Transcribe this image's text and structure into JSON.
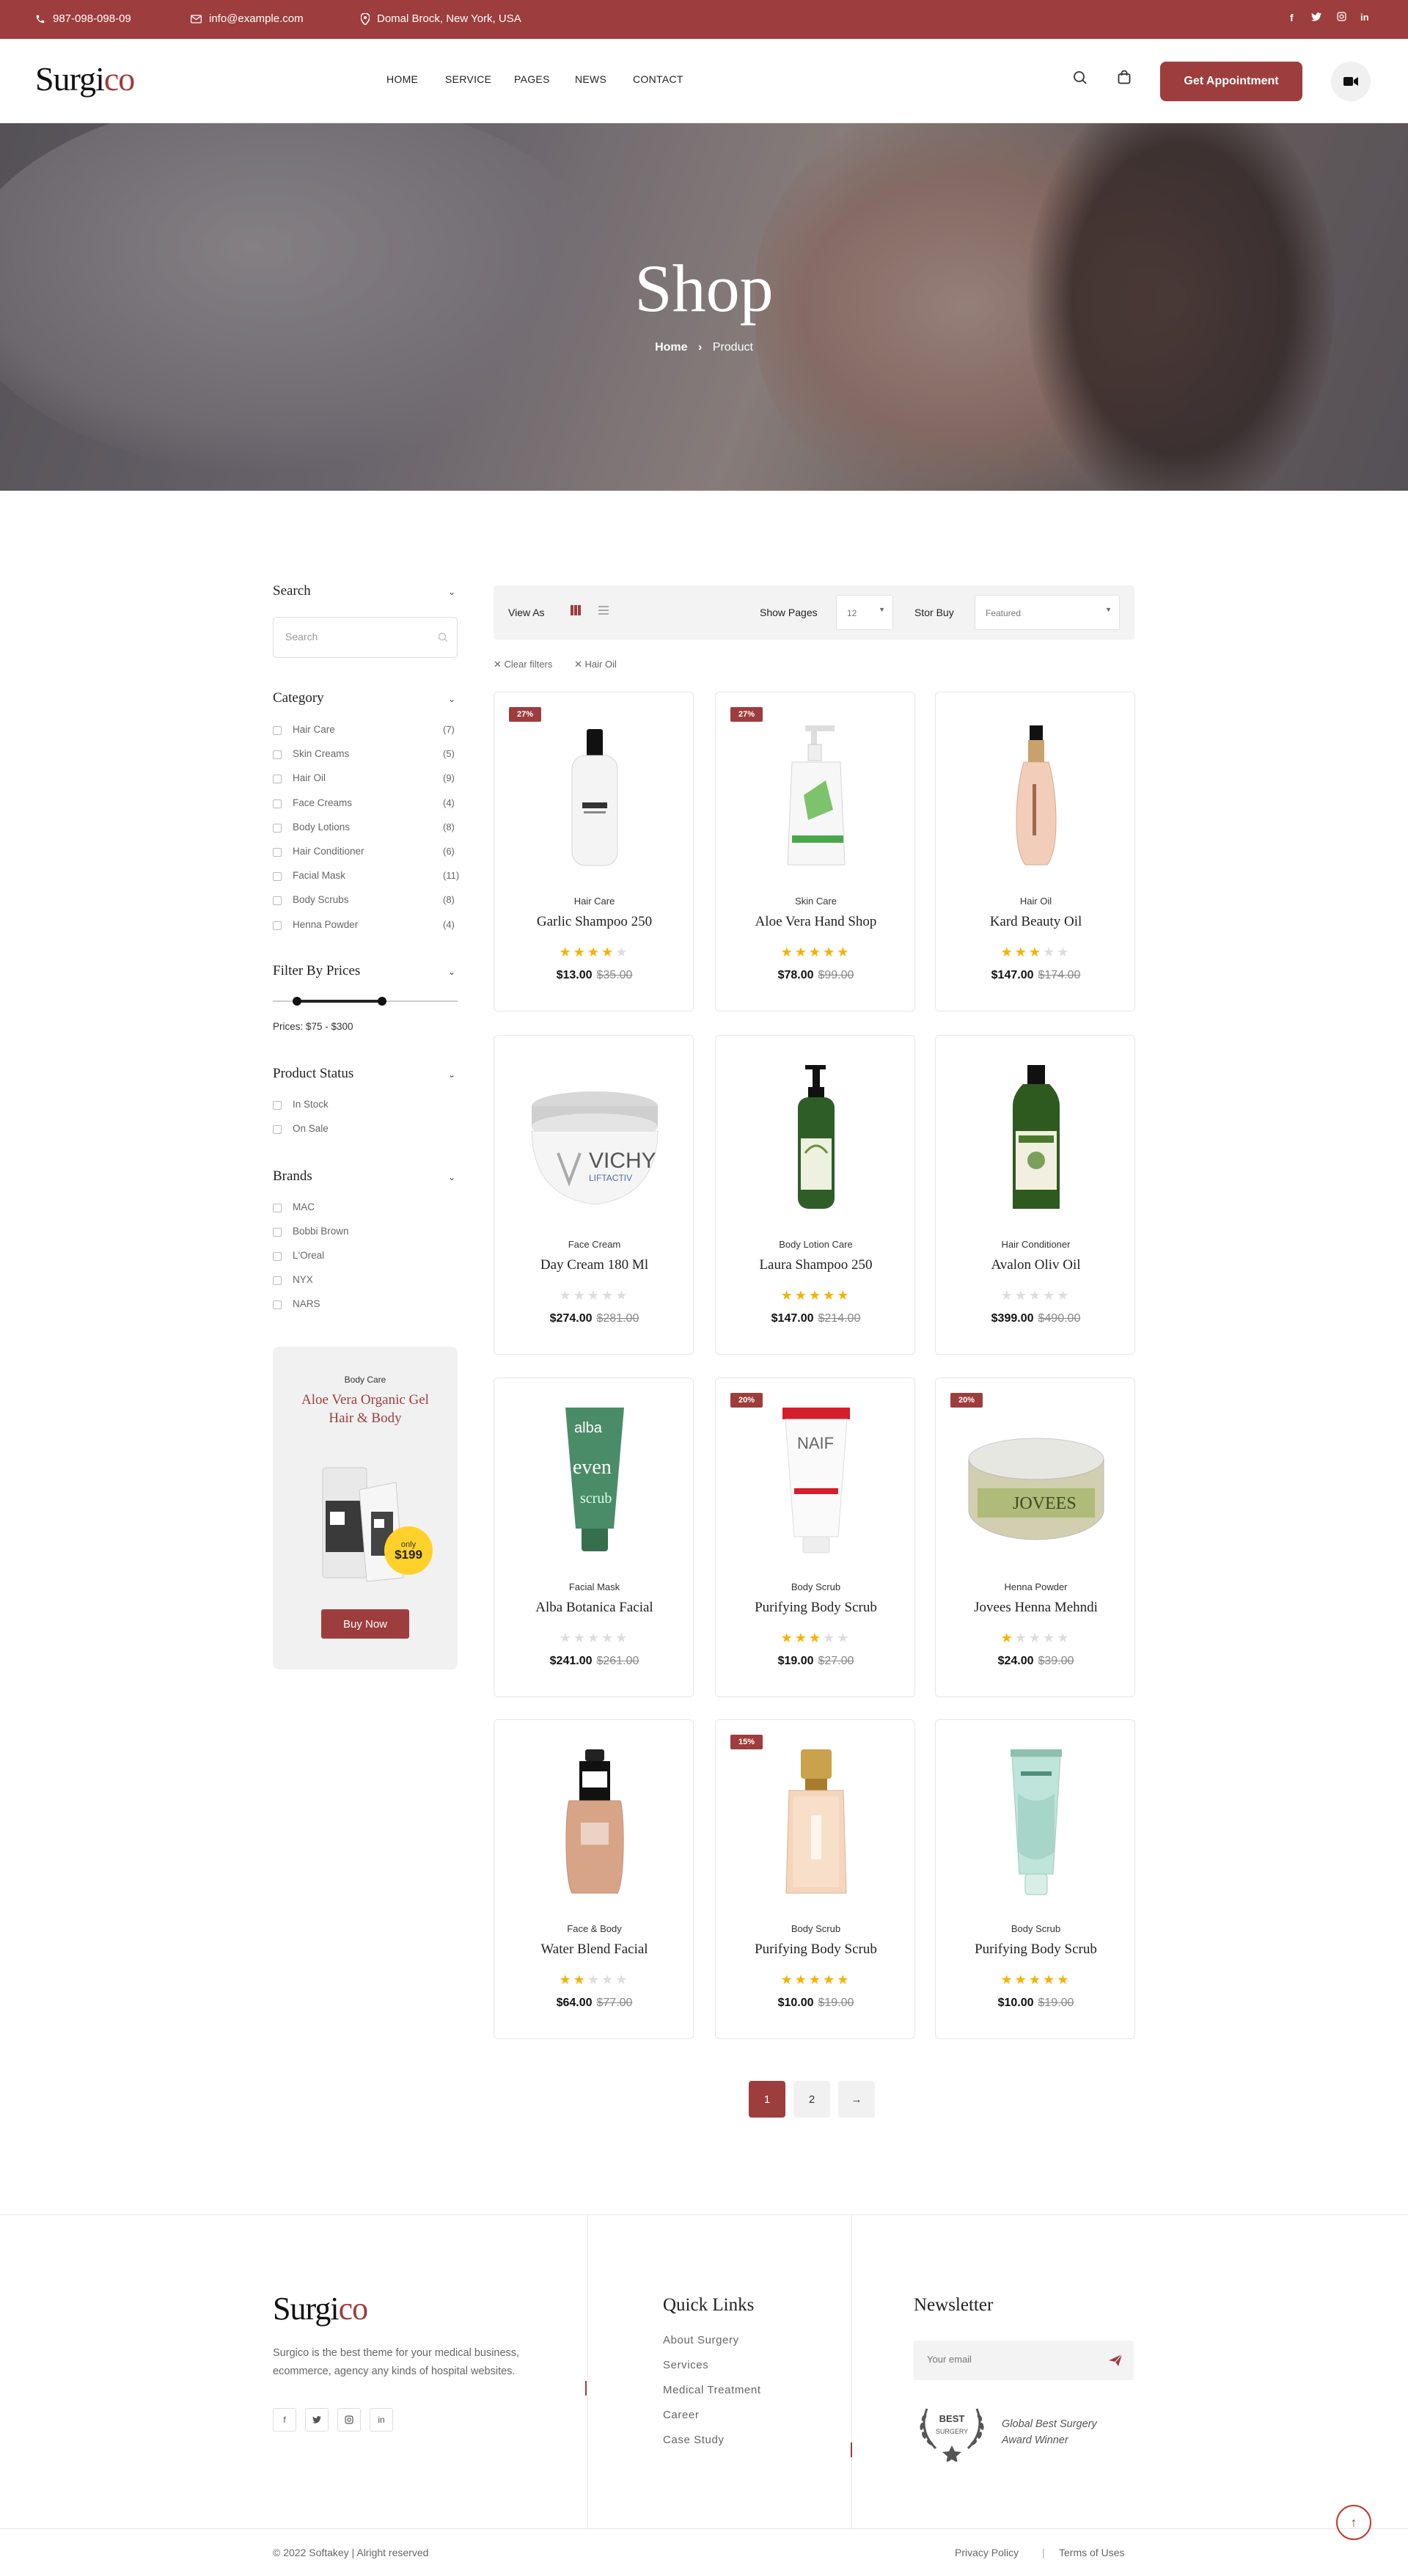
{
  "topbar": {
    "phone": "987-098-098-09",
    "email": "info@example.com",
    "address": "Domal Brock, New York, USA",
    "socials": [
      "f",
      "t",
      "ig",
      "in"
    ]
  },
  "header": {
    "logo_main": "Surgi",
    "logo_accent": "co",
    "nav": [
      "HOME",
      "SERVICE",
      "PAGES",
      "NEWS",
      "CONTACT"
    ],
    "cta": "Get Appointment"
  },
  "hero": {
    "title": "Shop",
    "breadcrumb_home": "Home",
    "breadcrumb_current": "Product"
  },
  "sidebar": {
    "search_title": "Search",
    "search_placeholder": "Search",
    "category_title": "Category",
    "categories": [
      {
        "label": "Hair Care",
        "count": "(7)"
      },
      {
        "label": "Skin Creams",
        "count": "(5)"
      },
      {
        "label": "Hair Oil",
        "count": "(9)"
      },
      {
        "label": "Face Creams",
        "count": "(4)"
      },
      {
        "label": "Body Lotions",
        "count": "(8)"
      },
      {
        "label": "Hair Conditioner",
        "count": "(6)"
      },
      {
        "label": "Facial Mask",
        "count": "(11)"
      },
      {
        "label": "Body Scrubs",
        "count": "(8)"
      },
      {
        "label": "Henna Powder",
        "count": "(4)"
      }
    ],
    "price_title": "Filter By Prices",
    "price_range_text": "Prices: $75 - $300",
    "price_min_fraction": 0.13,
    "price_max_fraction": 0.59,
    "status_title": "Product Status",
    "statuses": [
      "In Stock",
      "On Sale"
    ],
    "brands_title": "Brands",
    "brands": [
      "MAC",
      "Bobbi Brown",
      "L'Oreal",
      "NYX",
      "NARS"
    ],
    "promo": {
      "tag": "Body Care",
      "title": "Aloe Vera Organic Gel Hair & Body",
      "badge_top": "only",
      "badge_price": "$199",
      "button": "Buy Now"
    }
  },
  "toolbar": {
    "view_label": "View As",
    "show_label": "Show Pages",
    "show_value": "12",
    "sort_label": "Stor Buy",
    "sort_value": "Featured"
  },
  "filters": [
    "Clear filters",
    "Hair Oil"
  ],
  "products": [
    {
      "discount": "27%",
      "category": "Hair Care",
      "name": "Garlic Shampoo 250",
      "rating": 4,
      "price": "$13.00",
      "old": "$35.00",
      "img": "shampoo"
    },
    {
      "discount": "27%",
      "category": "Skin Care",
      "name": "Aloe Vera Hand Shop",
      "rating": 5,
      "price": "$78.00",
      "old": "$99.00",
      "img": "pump"
    },
    {
      "discount": "",
      "category": "Hair Oil",
      "name": "Kard Beauty Oil",
      "rating": 3,
      "price": "$147.00",
      "old": "$174.00",
      "img": "oil"
    },
    {
      "discount": "",
      "category": "Face Cream",
      "name": "Day Cream 180 Ml",
      "rating": 0,
      "price": "$274.00",
      "old": "$281.00",
      "img": "jar"
    },
    {
      "discount": "",
      "category": "Body Lotion Care",
      "name": "Laura Shampoo 250",
      "rating": 5,
      "price": "$147.00",
      "old": "$214.00",
      "img": "greenpump"
    },
    {
      "discount": "",
      "category": "Hair Conditioner",
      "name": "Avalon Oliv Oil",
      "rating": 0,
      "price": "$399.00",
      "old": "$490.00",
      "img": "greenbottle"
    },
    {
      "discount": "",
      "category": "Facial Mask",
      "name": "Alba Botanica Facial",
      "rating": 0,
      "price": "$241.00",
      "old": "$261.00",
      "img": "greentube"
    },
    {
      "discount": "20%",
      "category": "Body Scrub",
      "name": "Purifying Body Scrub",
      "rating": 3,
      "price": "$19.00",
      "old": "$27.00",
      "img": "whitetube"
    },
    {
      "discount": "20%",
      "category": "Henna Powder",
      "name": "Jovees Henna Mehndi",
      "rating": 1,
      "price": "$24.00",
      "old": "$39.00",
      "img": "tin"
    },
    {
      "discount": "",
      "category": "Face & Body",
      "name": "Water Blend Facial",
      "rating": 2,
      "price": "$64.00",
      "old": "$77.00",
      "img": "foundation"
    },
    {
      "discount": "15%",
      "category": "Body Scrub",
      "name": "Purifying Body Scrub",
      "rating": 5,
      "price": "$10.00",
      "old": "$19.00",
      "img": "perfume"
    },
    {
      "discount": "",
      "category": "Body Scrub",
      "name": "Purifying Body Scrub",
      "rating": 5,
      "price": "$10.00",
      "old": "$19.00",
      "img": "mintube"
    }
  ],
  "pagination": {
    "pages": [
      "1",
      "2"
    ],
    "next": "→"
  },
  "footer": {
    "about": "Surgico is the best theme for your medical business, ecommerce, agency any kinds of hospital websites.",
    "quick_title": "Quick Links",
    "links": [
      "About Surgery",
      "Services",
      "Medical Treatment",
      "Career",
      "Case Study"
    ],
    "news_title": "Newsletter",
    "email_placeholder": "Your email",
    "award_badge_top": "BEST",
    "award_badge_bottom": "SURGERY",
    "award_text": "Global Best Surgery Award Winner",
    "copyright": "© 2022 Softakey | Alright reserved",
    "privacy": "Privacy Policy",
    "terms": "Terms of Uses"
  },
  "colors": {
    "accent": "#9e3d3d",
    "star": "#f5b301"
  }
}
